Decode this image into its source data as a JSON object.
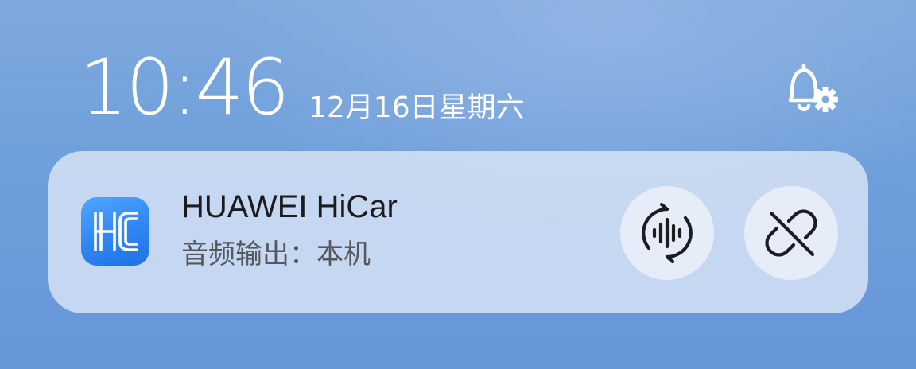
{
  "status": {
    "time": "10:46",
    "date": "12月16日星期六"
  },
  "notification_settings": {
    "icon": "bell-settings-icon"
  },
  "notification": {
    "app_name": "HUAWEI HiCar",
    "app_icon": "hicar-app-icon",
    "subtitle": "音频输出：本机",
    "actions": [
      {
        "icon": "audio-switch-icon"
      },
      {
        "icon": "disconnect-link-icon"
      }
    ]
  },
  "colors": {
    "background": "#6f9fdb",
    "card": "#d5e2f5",
    "button": "#e6edf8",
    "icon_blue": "#2f86f2"
  }
}
